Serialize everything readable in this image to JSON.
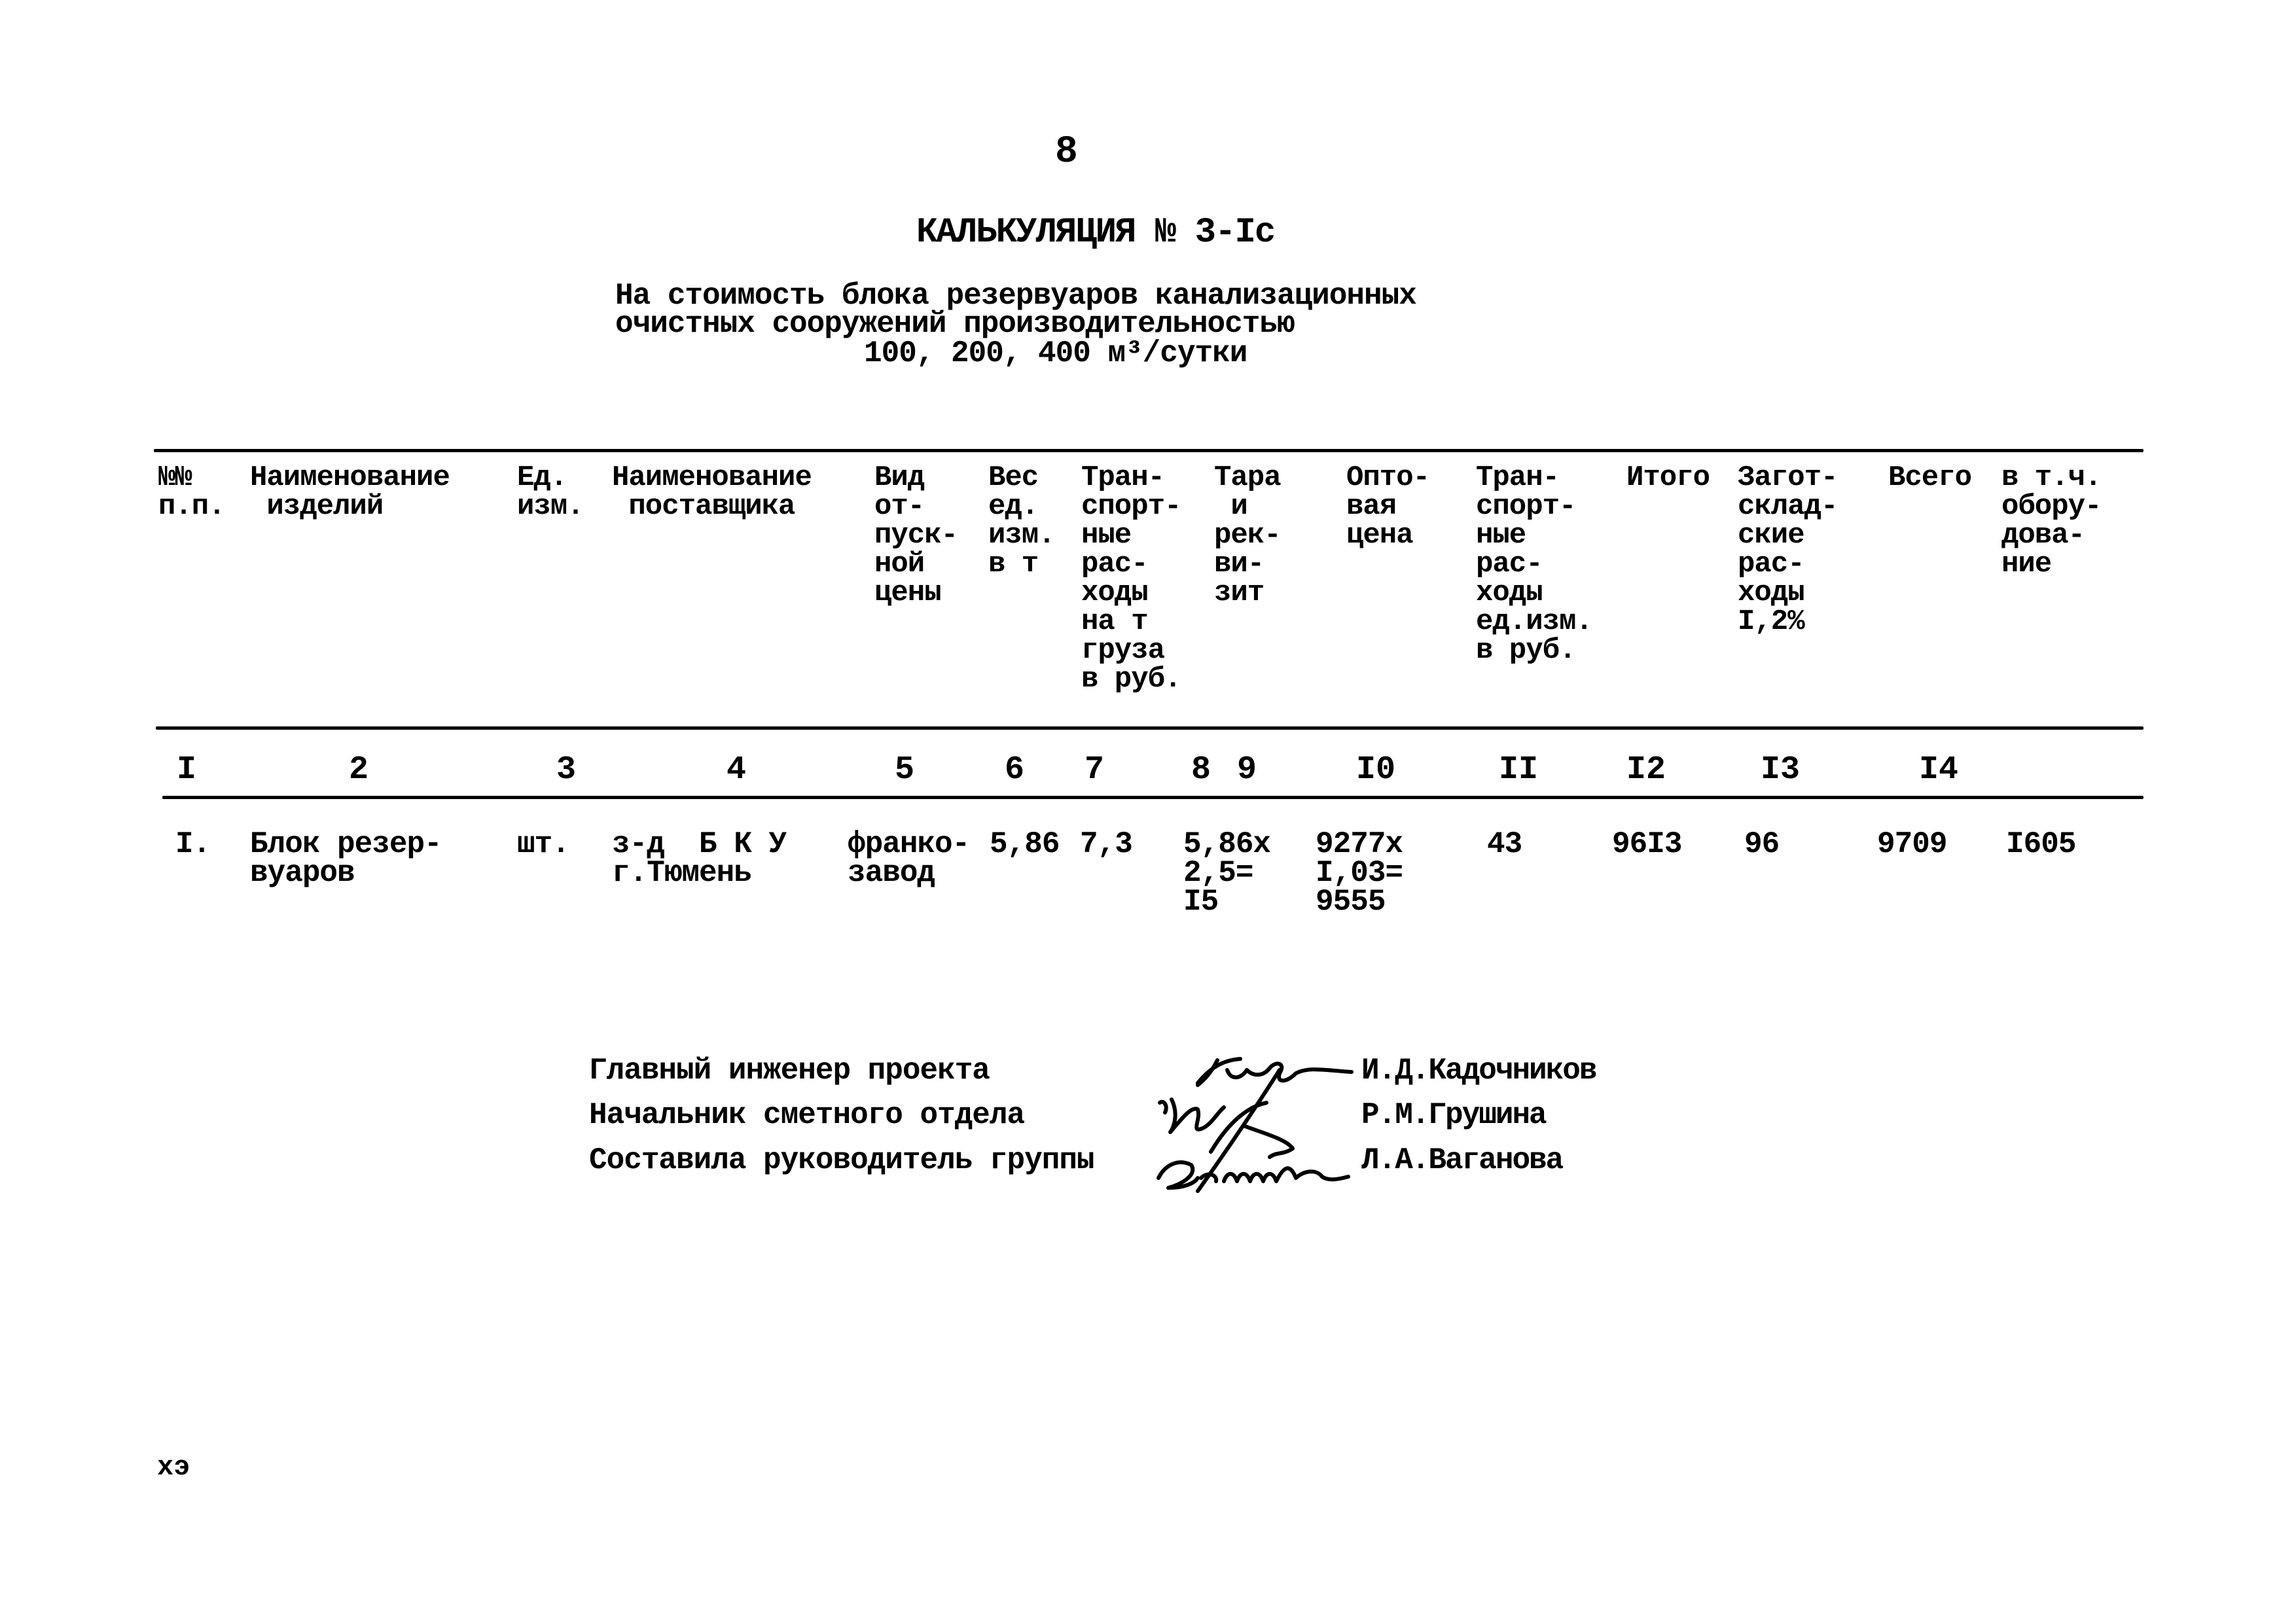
{
  "page_number": "8",
  "title": "КАЛЬКУЛЯЦИЯ № 3-Iс",
  "subtitle": {
    "line1": "На стоимость блока резервуаров канализационных",
    "line2": "очистных сооружений производительностью",
    "line3": "100, 200, 400 м³/сутки"
  },
  "table": {
    "headers": [
      "№№\nп.п.",
      "Наименование\n изделий",
      "Ед.\nизм.",
      "Наименование\n поставщика",
      "Вид\nот-\nпуск-\nной\nцены",
      "Вес\nед.\nизм.\nв т",
      "Тран-\nспорт-\nные\nрас-\nходы\nна т\nгруза\nв руб.",
      "Тара\n и\nрек-\nви-\nзит",
      "Опто-\nвая\nцена",
      "Тран-\nспорт-\nные\nрас-\nходы\nед.изм.\nв руб.",
      "Итого",
      "Загот-\nсклад-\nские\nрас-\nходы\nI,2%",
      "Всего",
      "в т.ч.\nобору-\nдова-\nние"
    ],
    "column_numbers": [
      "I",
      "2",
      "3",
      "4",
      "5",
      "6",
      "7",
      "8",
      "9",
      "I0",
      "II",
      "I2",
      "I3",
      "I4"
    ],
    "rows": [
      {
        "no": "I.",
        "item_name": "Блок резер-\nвуаров",
        "unit": "шт.",
        "supplier": "з-д  Б К У\nг.Тюмень",
        "price_type": "франко-\nзавод",
        "unit_weight_t": "5,86",
        "transport_per_t_rub": "7,3",
        "packaging": "5,86х\n2,5=\nI5",
        "wholesale_price": "9277х\nI,03=\n9555",
        "transport_per_unit_rub": "43",
        "subtotal": "96I3",
        "procurement_storage": "96",
        "total": "9709",
        "incl_equipment": "I605"
      }
    ]
  },
  "signatures": [
    {
      "role": "Главный инженер проекта",
      "name": "И.Д.Кадочников"
    },
    {
      "role": "Начальник сметного отдела",
      "name": "Р.М.Грушина"
    },
    {
      "role": "Составила руководитель группы",
      "name": "Л.А.Ваганова"
    }
  ],
  "footer_mark": "хэ"
}
